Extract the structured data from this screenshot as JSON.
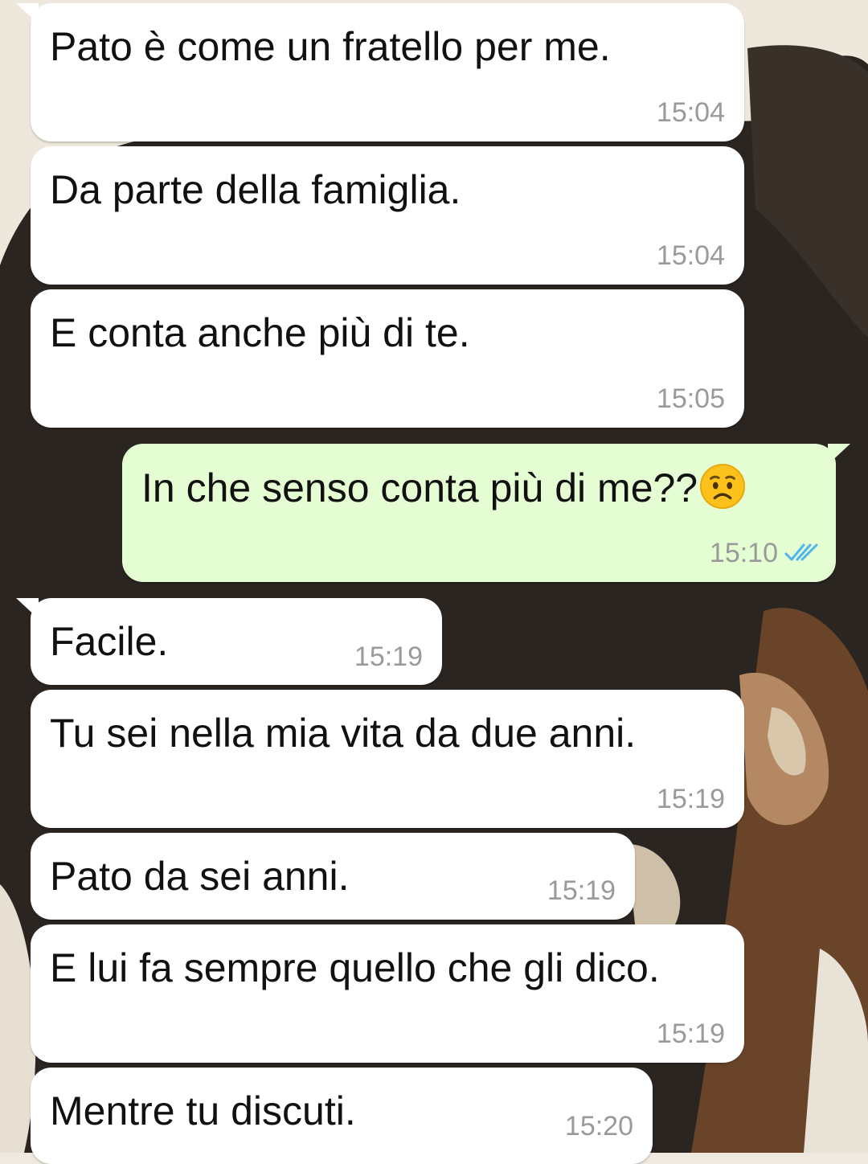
{
  "chat": {
    "messages": [
      {
        "text": "Pato è come un fratello per me.",
        "time": "15:04",
        "direction": "incoming"
      },
      {
        "text": "Da parte della famiglia.",
        "time": "15:04",
        "direction": "incoming"
      },
      {
        "text": "E conta anche più di te.",
        "time": "15:05",
        "direction": "incoming"
      },
      {
        "text": "In che senso conta più di me??",
        "time": "15:10",
        "direction": "outgoing",
        "emoji": "worried-face",
        "status": "read"
      },
      {
        "text": "Facile.",
        "time": "15:19",
        "direction": "incoming"
      },
      {
        "text": "Tu sei nella mia vita da due anni.",
        "time": "15:19",
        "direction": "incoming"
      },
      {
        "text": "Pato da sei anni.",
        "time": "15:19",
        "direction": "incoming"
      },
      {
        "text": "E lui fa sempre quello che gli dico.",
        "time": "15:19",
        "direction": "incoming"
      },
      {
        "text": "Mentre tu discuti.",
        "time": "15:20",
        "direction": "incoming"
      }
    ]
  },
  "colors": {
    "incoming_bubble": "#ffffff",
    "outgoing_bubble": "#e4fdd2",
    "timestamp": "#9a9a9a",
    "read_ticks": "#4fb6ec"
  }
}
